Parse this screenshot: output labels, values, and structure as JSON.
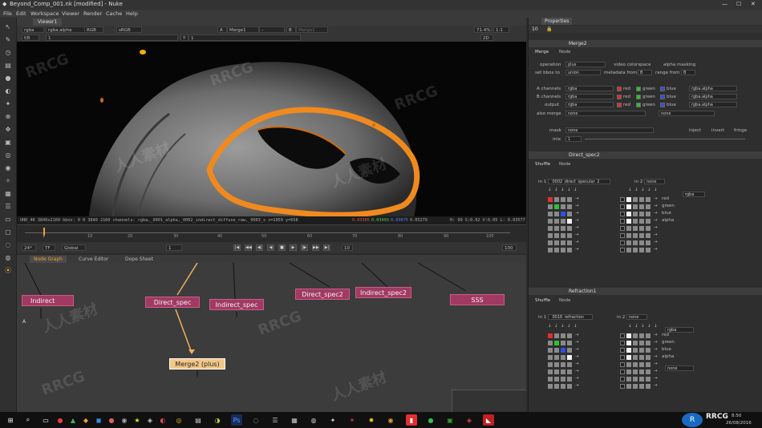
{
  "app": {
    "title": "Beyond_Comp_001.nk [modified] - Nuke",
    "watermark": "RRCG",
    "watermark_cn": "人人素材"
  },
  "menu": [
    "File",
    "Edit",
    "Workspace",
    "Viewer",
    "Render",
    "Cache",
    "Help"
  ],
  "viewer": {
    "tab": "Viewer1",
    "channels": "rgba",
    "alpha_channel": "rgba.alpha",
    "color_mode": "RGB",
    "colorspace": "sRGB",
    "input_a": "A",
    "input_a_node": "Merge1",
    "input_dash": "-",
    "input_b": "B",
    "input_b_node": "Merge1",
    "zoom": "71.4%",
    "ratio": "1:1",
    "f_label": "f/8",
    "frame_val": "1",
    "y_label": "Y",
    "y_val": "1",
    "view_2d": "2D",
    "info": "UHD_4K 3840x2160  bbox: 0 0 3840 2160 channels: rgba,_0001_alpha,_0002_indirect_diffuse_raw,_0003_s  x=1959 y=658",
    "pixel_r": "0.03305",
    "pixel_g": "0.03493",
    "pixel_b": "0.03675",
    "pixel_a": "0.05279",
    "hsv_info": "H: 99 S:0.02 V:0.05  L: 0.03577"
  },
  "timeline": {
    "ticks": [
      "1",
      "10",
      "20",
      "30",
      "40",
      "50",
      "60",
      "70",
      "80",
      "90",
      "100"
    ],
    "fps": "24*",
    "tf": "TF",
    "mode": "Global",
    "current_frame": "1",
    "step": "10",
    "end_frame": "100"
  },
  "nodegraph": {
    "tabs": [
      "Node Graph",
      "Curve Editor",
      "Dope Sheet"
    ],
    "nodes": [
      {
        "label": "Indirect"
      },
      {
        "label": "Direct_spec"
      },
      {
        "label": "Indirect_spec"
      },
      {
        "label": "Direct_spec2"
      },
      {
        "label": "Indirect_spec2"
      },
      {
        "label": "SSS"
      },
      {
        "label": "Merge2 (plus)"
      }
    ],
    "input_a": "A",
    "colors": {
      "node": "#a13a63",
      "merge": "#f3c787",
      "pipe": "#f0b060"
    }
  },
  "properties": {
    "title": "Properties",
    "max_panels": "10",
    "merge_panel": {
      "name": "Merge2",
      "tabs": [
        "Merge",
        "Node"
      ],
      "operation_label": "operation",
      "operation": "plus",
      "video_colorspace": "video colorspace",
      "alpha_masking": "alpha masking",
      "set_bbox_label": "set bbox to",
      "set_bbox": "union",
      "metadata_label": "metadata from",
      "metadata": "B",
      "range_label": "range from",
      "range": "B",
      "a_channels_label": "A channels",
      "a_channels": "rgba",
      "a_alpha": "rgba.alpha",
      "b_channels_label": "B channels",
      "b_channels": "rgba",
      "b_alpha": "rgba.alpha",
      "output_label": "output",
      "output": "rgba",
      "output_alpha": "rgba.alpha",
      "also_merge_label": "also merge",
      "also_merge": "none",
      "also_merge2": "none",
      "ch_red": "red",
      "ch_green": "green",
      "ch_blue": "blue",
      "mask_label": "mask",
      "mask": "none",
      "inject": "inject",
      "invert": "invert",
      "fringe": "fringe",
      "mix_label": "mix",
      "mix": "1"
    },
    "shuffle1": {
      "name": "Direct_spec2",
      "tabs": [
        "Shuffle",
        "Node"
      ],
      "in1_label": "in 1",
      "in1": "_0002_direct_specular_2",
      "in2_label": "in 2",
      "in2": "none",
      "out": "rgba",
      "outputs": [
        "red",
        "green",
        "blue",
        "alpha"
      ]
    },
    "shuffle2": {
      "name": "Refraction1",
      "tabs": [
        "Shuffle",
        "Node"
      ],
      "in1_label": "in 1",
      "in1": "_0016_refraction",
      "in2_label": "in 2",
      "in2": "none",
      "out": "rgba",
      "out2": "none",
      "outputs": [
        "red",
        "green",
        "blue",
        "alpha"
      ]
    }
  },
  "taskbar": {
    "time": "8:50",
    "date": "26/08/2016"
  }
}
